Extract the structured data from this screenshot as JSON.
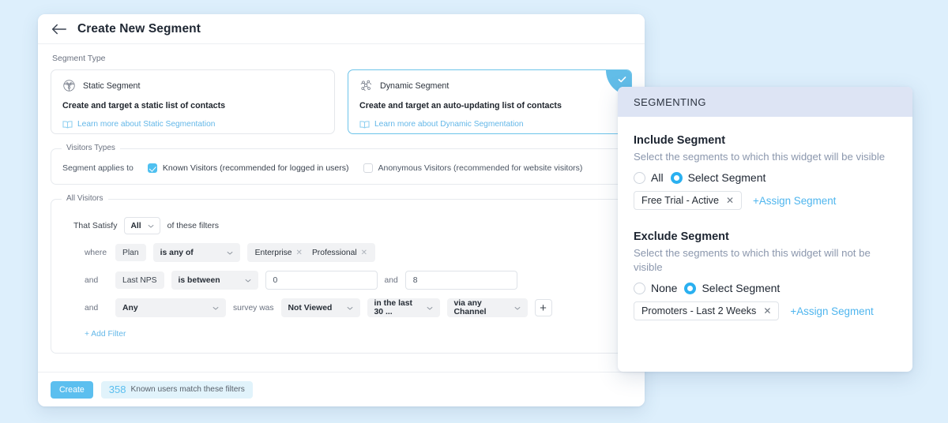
{
  "header": {
    "back_icon": "arrow-left-icon",
    "title": "Create New Segment"
  },
  "segment_type": {
    "label": "Segment Type",
    "cards": [
      {
        "icon": "network-circle-icon",
        "title": "Static Segment",
        "description": "Create and target a static list of contacts",
        "link_icon": "book-icon",
        "link": "Learn more about Static Segmentation",
        "selected": false
      },
      {
        "icon": "network-nodes-icon",
        "title": "Dynamic Segment",
        "description": "Create and target an auto-updating list of contacts",
        "link_icon": "book-icon",
        "link": "Learn more about Dynamic Segmentation",
        "selected": true,
        "badge_icon": "check-icon"
      }
    ]
  },
  "visitors_types": {
    "legend": "Visitors Types",
    "label": "Segment applies to",
    "options": [
      {
        "label": "Known Visitors (recommended for logged in users)",
        "checked": true
      },
      {
        "label": "Anonymous Visitors (recommended for website visitors)",
        "checked": false
      }
    ]
  },
  "all_visitors": {
    "legend": "All Visitors",
    "satisfy_prefix": "That Satisfy",
    "satisfy_value": "All",
    "satisfy_suffix": "of these filters",
    "add_filter": "+ Add Filter",
    "filters": [
      {
        "conjunction": "where",
        "field": "Plan",
        "operator": "is any of",
        "tags": [
          "Enterprise",
          "Professional"
        ]
      },
      {
        "conjunction": "and",
        "field": "Last NPS",
        "operator": "is between",
        "value_low": "0",
        "value_high": "8",
        "between_word": "and"
      },
      {
        "conjunction": "and",
        "survey_select": "Any",
        "survey_label": "survey was",
        "viewed_state": "Not Viewed",
        "timeframe": "in the last 30 ...",
        "channel": "via any Channel",
        "add_icon": "plus-icon"
      }
    ]
  },
  "footer": {
    "create_label": "Create",
    "match_count": "358",
    "match_text": "Known users match these filters"
  },
  "segmenting_panel": {
    "title": "SEGMENTING",
    "include": {
      "title": "Include Segment",
      "subtitle": "Select the segments to which this widget will be visible",
      "radio_all": "All",
      "radio_select": "Select Segment",
      "selected_radio": "select",
      "chip": "Free Trial - Active",
      "chip_remove_icon": "close-icon",
      "assign_link": "+Assign Segment"
    },
    "exclude": {
      "title": "Exclude Segment",
      "subtitle": "Select the segments to which this widget will not be visible",
      "radio_none": "None",
      "radio_select": "Select Segment",
      "selected_radio": "select",
      "chip": "Promoters - Last 2 Weeks",
      "chip_remove_icon": "close-icon",
      "assign_link": "+Assign Segment"
    }
  },
  "colors": {
    "page_background": "#ddeffc",
    "accent_blue": "#5cbfef",
    "radio_blue": "#2ab0f0",
    "panel_header": "#dde4f4",
    "link_blue": "#63b7e8"
  }
}
